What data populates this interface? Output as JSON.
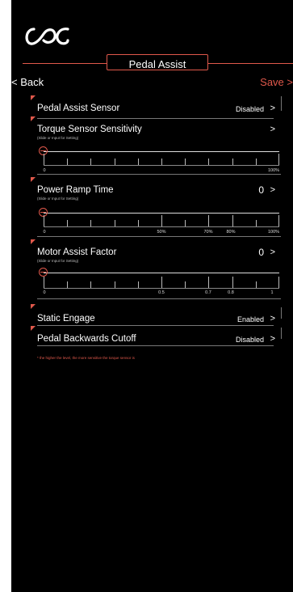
{
  "header": {
    "title": "Pedal Assist",
    "back_label": "< Back",
    "save_label": "Save >"
  },
  "rows": {
    "pedal_sensor": {
      "label": "Pedal Assist Sensor",
      "value": "Disabled",
      "chevron": ">"
    },
    "torque": {
      "label": "Torque Sensor Sensitivity",
      "hint": "(Slide or Input for Setting)",
      "chevron": ">"
    },
    "ramp": {
      "label": "Power Ramp Time",
      "hint": "(Slide or Input for Setting)",
      "value": "0",
      "chevron": ">"
    },
    "motor": {
      "label": "Motor Assist Factor",
      "hint": "(Slide or Input for Setting)",
      "value": "0",
      "chevron": ">"
    },
    "static": {
      "label": "Static Engage",
      "value": "Enabled",
      "chevron": ">"
    },
    "backwards": {
      "label": "Pedal Backwards Cutoff",
      "value": "Disabled",
      "chevron": ">"
    }
  },
  "scales": {
    "torque": {
      "min": "0",
      "max": "100%"
    },
    "ramp": {
      "min": "0",
      "t50": "50%",
      "t70": "70%",
      "t80": "80%",
      "max": "100%"
    },
    "motor": {
      "min": "0",
      "t05": "0.5",
      "t07": "0.7",
      "t08": "0.8",
      "max": "1"
    }
  },
  "note": "* the higher the level, the more sensitive the torque sensor is",
  "colors": {
    "accent": "#e0584b",
    "background": "#000000"
  }
}
